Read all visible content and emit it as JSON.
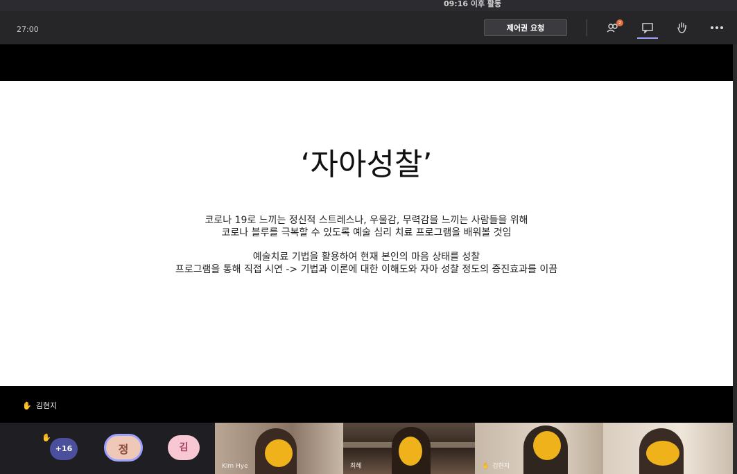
{
  "window": {
    "title": "09:16 이후 활동"
  },
  "toolbar": {
    "timer": "27:00",
    "request_control_label": "제어권 요청",
    "participants_badge": "2",
    "icons": [
      "participants-icon",
      "chat-icon",
      "raise-hand-icon",
      "more-options-icon"
    ]
  },
  "slide": {
    "title": "‘자아성찰’",
    "lines": [
      "코로나 19로 느끼는 정신적 스트레스나, 우울감, 무력감을 느끼는 사람들을 위해",
      "코로나 블루를 극복할 수 있도록 예술 심리 치료 프로그램을 배워볼 것임",
      "예술치료 기법을 활용하여 현재 본인의 마음 상태를 성찰",
      "프로그램을 통해 직접 시연 -> 기법과 이론에 대한 이해도와 자아 성찰 정도의 증진효과를 이끔"
    ]
  },
  "raised_hand": {
    "name": "김현지"
  },
  "participants": {
    "more_count": "+16",
    "avatars": [
      {
        "initial": "정",
        "color": "#f0c8b8"
      },
      {
        "initial": "김",
        "color": "#f7c7d4"
      }
    ],
    "video_tiles": [
      {
        "label": "Kim Hye"
      },
      {
        "label": "최혜"
      },
      {
        "label": "김현지"
      },
      {
        "label": ""
      }
    ]
  },
  "colors": {
    "accent": "#9ea2ff",
    "hand": "#f3b82d",
    "badge": "#e86a3a"
  }
}
